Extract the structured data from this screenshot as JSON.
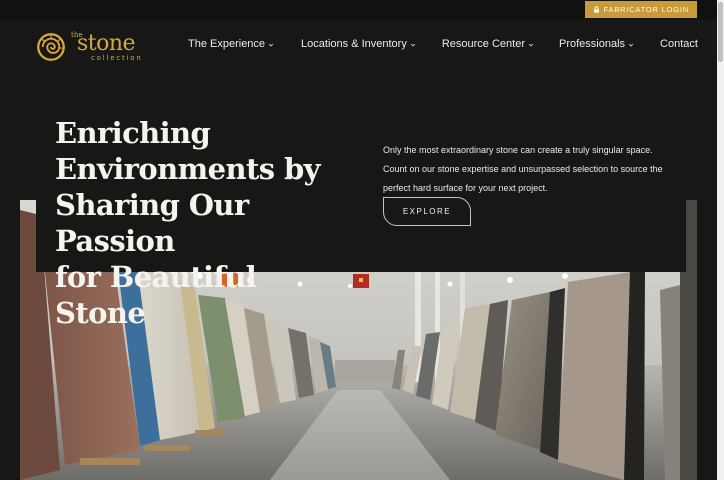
{
  "topbar": {
    "login_label": "FABRICATOR LOGIN",
    "login_icon": "lock-icon",
    "accent": "#c99a3a"
  },
  "brand": {
    "word_the": "the",
    "word_stone": "stone",
    "word_collection": "collection",
    "color": "#d9a93d"
  },
  "nav": {
    "items": [
      {
        "label": "The Experience",
        "has_dropdown": true
      },
      {
        "label": "Locations & Inventory",
        "has_dropdown": true
      },
      {
        "label": "Resource Center",
        "has_dropdown": true
      },
      {
        "label": "Professionals",
        "has_dropdown": true
      },
      {
        "label": "Contact",
        "has_dropdown": false
      }
    ]
  },
  "hero": {
    "title_lines": [
      "Enriching",
      "Environments by",
      "Sharing Our Passion",
      "for Beautiful Stone"
    ],
    "copy": "Only the most extraordinary stone can create a truly singular space. Count on our stone expertise and unsurpassed selection to source the perfect hard surface for your next project.",
    "cta_label": "EXPLORE"
  }
}
